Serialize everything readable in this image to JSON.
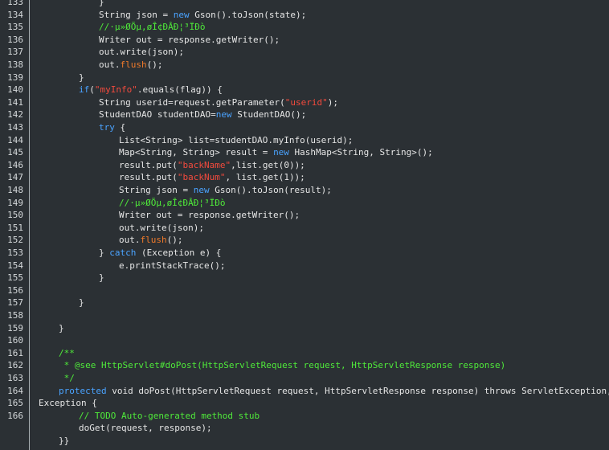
{
  "editor": {
    "lines": [
      {
        "number": "133",
        "indent": 3,
        "segments": [
          {
            "t": "}",
            "c": "id"
          }
        ]
      },
      {
        "number": "134",
        "indent": 3,
        "segments": [
          {
            "t": "String json = ",
            "c": "id"
          },
          {
            "t": "new",
            "c": "kw"
          },
          {
            "t": " Gson().toJson(state);",
            "c": "id"
          }
        ]
      },
      {
        "number": "135",
        "indent": 3,
        "segments": [
          {
            "t": "//·µ»ØÕµ,øÎ¢ÐÂÐ¦³ÏÐò",
            "c": "com"
          }
        ]
      },
      {
        "number": "136",
        "indent": 3,
        "segments": [
          {
            "t": "Writer out = response.getWriter();",
            "c": "id"
          }
        ]
      },
      {
        "number": "137",
        "indent": 3,
        "segments": [
          {
            "t": "out.write(json);",
            "c": "id"
          }
        ]
      },
      {
        "number": "138",
        "indent": 3,
        "segments": [
          {
            "t": "out.",
            "c": "id"
          },
          {
            "t": "flush",
            "c": "flush"
          },
          {
            "t": "();",
            "c": "id"
          }
        ]
      },
      {
        "number": "139",
        "indent": 2,
        "segments": [
          {
            "t": "}",
            "c": "id"
          }
        ]
      },
      {
        "number": "140",
        "indent": 2,
        "segments": [
          {
            "t": "if",
            "c": "kw"
          },
          {
            "t": "(",
            "c": "id"
          },
          {
            "t": "\"myInfo\"",
            "c": "str"
          },
          {
            "t": ".equals(flag)) {",
            "c": "id"
          }
        ]
      },
      {
        "number": "141",
        "indent": 3,
        "segments": [
          {
            "t": "String userid=request.getParameter(",
            "c": "id"
          },
          {
            "t": "\"userid\"",
            "c": "str"
          },
          {
            "t": ");",
            "c": "id"
          }
        ]
      },
      {
        "number": "142",
        "indent": 3,
        "segments": [
          {
            "t": "StudentDAO studentDAO=",
            "c": "id"
          },
          {
            "t": "new",
            "c": "kw"
          },
          {
            "t": " StudentDAO();",
            "c": "id"
          }
        ]
      },
      {
        "number": "143",
        "indent": 3,
        "segments": [
          {
            "t": "try",
            "c": "kw"
          },
          {
            "t": " {",
            "c": "id"
          }
        ]
      },
      {
        "number": "144",
        "indent": 4,
        "segments": [
          {
            "t": "List<String> list=studentDAO.myInfo(userid);",
            "c": "id"
          }
        ]
      },
      {
        "number": "145",
        "indent": 4,
        "segments": [
          {
            "t": "Map<String, String> result = ",
            "c": "id"
          },
          {
            "t": "new",
            "c": "kw"
          },
          {
            "t": " HashMap<String, String>();",
            "c": "id"
          }
        ]
      },
      {
        "number": "146",
        "indent": 4,
        "segments": [
          {
            "t": "result.put(",
            "c": "id"
          },
          {
            "t": "\"backName\"",
            "c": "str"
          },
          {
            "t": ",list.get(0));",
            "c": "id"
          }
        ]
      },
      {
        "number": "147",
        "indent": 4,
        "segments": [
          {
            "t": "result.put(",
            "c": "id"
          },
          {
            "t": "\"backNum\"",
            "c": "str"
          },
          {
            "t": ", list.get(1));",
            "c": "id"
          }
        ]
      },
      {
        "number": "148",
        "indent": 4,
        "segments": [
          {
            "t": "String json = ",
            "c": "id"
          },
          {
            "t": "new",
            "c": "kw"
          },
          {
            "t": " Gson().toJson(result);",
            "c": "id"
          }
        ]
      },
      {
        "number": "149",
        "indent": 4,
        "segments": [
          {
            "t": "//·µ»ØÕµ,øÎ¢ÐÂÐ¦³ÏÐò",
            "c": "com"
          }
        ]
      },
      {
        "number": "150",
        "indent": 4,
        "segments": [
          {
            "t": "Writer out = response.getWriter();",
            "c": "id"
          }
        ]
      },
      {
        "number": "151",
        "indent": 4,
        "segments": [
          {
            "t": "out.write(json);",
            "c": "id"
          }
        ]
      },
      {
        "number": "152",
        "indent": 4,
        "segments": [
          {
            "t": "out.",
            "c": "id"
          },
          {
            "t": "flush",
            "c": "flush"
          },
          {
            "t": "();",
            "c": "id"
          }
        ]
      },
      {
        "number": "153",
        "indent": 3,
        "segments": [
          {
            "t": "} ",
            "c": "id"
          },
          {
            "t": "catch",
            "c": "kw"
          },
          {
            "t": " (Exception e) {",
            "c": "id"
          }
        ]
      },
      {
        "number": "154",
        "indent": 4,
        "segments": [
          {
            "t": "e.printStackTrace();",
            "c": "id"
          }
        ]
      },
      {
        "number": "155",
        "indent": 3,
        "segments": [
          {
            "t": "}",
            "c": "id"
          }
        ]
      },
      {
        "number": "156",
        "indent": 0,
        "segments": []
      },
      {
        "number": "157",
        "indent": 2,
        "segments": [
          {
            "t": "}",
            "c": "id"
          }
        ]
      },
      {
        "number": "158",
        "indent": 0,
        "segments": []
      },
      {
        "number": "159",
        "indent": 1,
        "segments": [
          {
            "t": "}",
            "c": "id"
          }
        ]
      },
      {
        "number": "160",
        "indent": 0,
        "segments": []
      },
      {
        "number": "161",
        "indent": 1,
        "segments": [
          {
            "t": "/**",
            "c": "com"
          }
        ]
      },
      {
        "number": "162",
        "indent": 1,
        "segments": [
          {
            "t": " * @see HttpServlet#doPost(HttpServletRequest request, HttpServletResponse response)",
            "c": "com"
          }
        ]
      },
      {
        "number": "163",
        "indent": 1,
        "segments": [
          {
            "t": " */",
            "c": "com"
          }
        ]
      },
      {
        "number": "164",
        "indent": 1,
        "segments": [
          {
            "t": "protected",
            "c": "kw"
          },
          {
            "t": " void doPost(HttpServletRequest request, HttpServletResponse response) throws ServletException, IO",
            "c": "id"
          }
        ]
      },
      {
        "number": "165",
        "indent": 0,
        "segments": [
          {
            "t": "Exception {",
            "c": "id"
          }
        ]
      },
      {
        "number": "166",
        "indent": 2,
        "segments": [
          {
            "t": "// TODO Auto-generated method stub",
            "c": "com"
          }
        ]
      },
      {
        "number": "",
        "indent": 2,
        "segments": [
          {
            "t": "doGet(request, response);",
            "c": "id"
          }
        ]
      },
      {
        "number": "",
        "indent": 1,
        "segments": [
          {
            "t": "}}",
            "c": "id"
          }
        ]
      }
    ]
  },
  "colors": {
    "background": "#2b3034",
    "keyword": "#4aa3ff",
    "string": "#f24a3d",
    "comment": "#4fe93a",
    "method_highlight": "#f07a2a",
    "text": "#e6e6e6"
  }
}
